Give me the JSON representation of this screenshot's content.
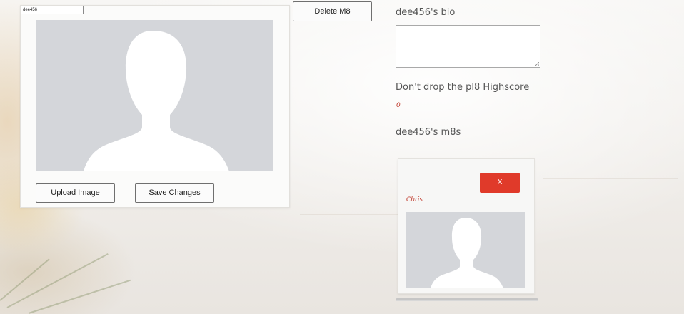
{
  "profile": {
    "username_value": "dee456",
    "avatar_icon": "person-silhouette-icon",
    "upload_label": "Upload Image",
    "save_label": "Save Changes"
  },
  "actions": {
    "delete_label": "Delete M8"
  },
  "bio": {
    "heading": "dee456's bio",
    "value": ""
  },
  "highscore": {
    "heading": "Don't drop the pl8 Highscore",
    "value": "0"
  },
  "m8s": {
    "heading": "dee456's m8s",
    "items": [
      {
        "remove_label": "X",
        "name": "Chris",
        "avatar_icon": "person-silhouette-icon"
      }
    ]
  },
  "colors": {
    "accent_red": "#e03a2a",
    "text_red": "#c0392b",
    "avatar_placeholder": "#d4d6da"
  }
}
